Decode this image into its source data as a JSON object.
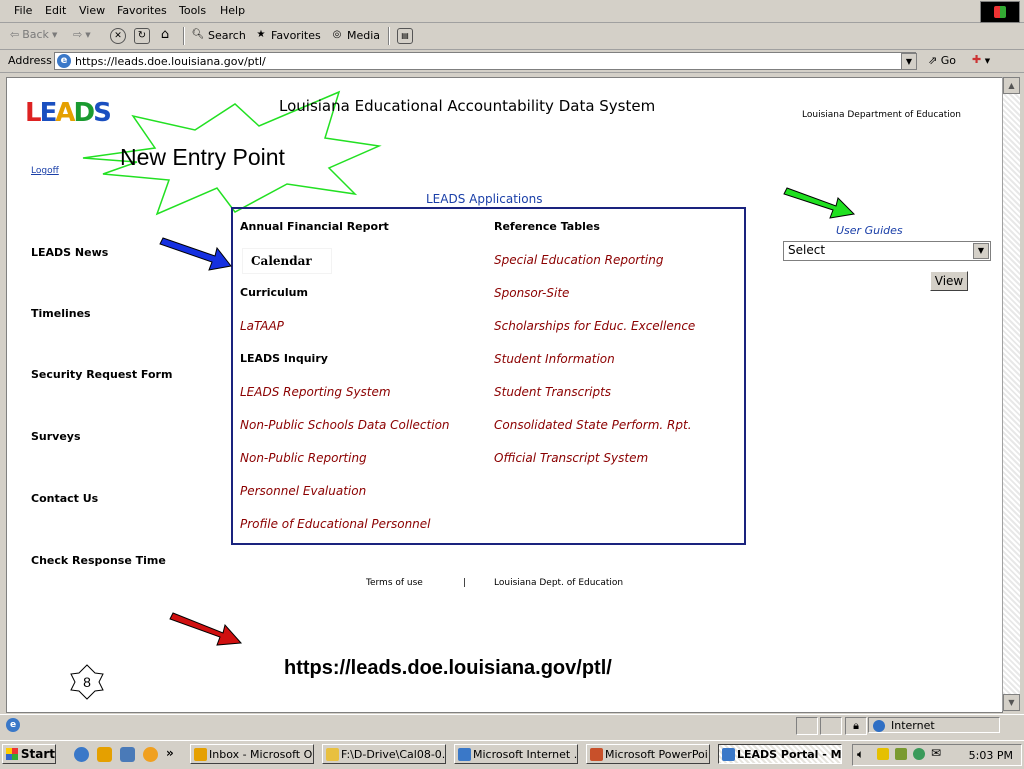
{
  "menu": [
    "File",
    "Edit",
    "View",
    "Favorites",
    "Tools",
    "Help"
  ],
  "toolbar": {
    "back": "Back",
    "search": "Search",
    "favorites": "Favorites",
    "media": "Media"
  },
  "address": {
    "label": "Address",
    "url": "https://leads.doe.louisiana.gov/ptl/",
    "go": "Go"
  },
  "page": {
    "logo_letters": [
      "L",
      "E",
      "A",
      "D",
      "S"
    ],
    "site_title": "Louisiana Educational Accountability Data System",
    "department": "Louisiana Department of Education",
    "logoff": "Logoff",
    "annotation_burst": "New Entry Point",
    "nav": [
      "LEADS News",
      "Timelines",
      "Security Request Form",
      "Surveys",
      "Contact Us",
      "Check Response Time"
    ],
    "apps_title": "LEADS Applications",
    "apps_col1": [
      {
        "text": "Annual Financial Report",
        "kind": "header"
      },
      {
        "text": "Calendar",
        "kind": "callout"
      },
      {
        "text": "Curriculum",
        "kind": "header"
      },
      {
        "text": "LaTAAP",
        "kind": "link"
      },
      {
        "text": "LEADS Inquiry",
        "kind": "header"
      },
      {
        "text": "LEADS Reporting System",
        "kind": "link"
      },
      {
        "text": "Non-Public Schools Data Collection",
        "kind": "link"
      },
      {
        "text": "Non-Public Reporting",
        "kind": "link"
      },
      {
        "text": "Personnel Evaluation",
        "kind": "link"
      },
      {
        "text": "Profile of Educational Personnel",
        "kind": "link"
      }
    ],
    "apps_col2": [
      {
        "text": "Reference Tables",
        "kind": "header"
      },
      {
        "text": "Special Education Reporting",
        "kind": "link"
      },
      {
        "text": "Sponsor-Site",
        "kind": "link"
      },
      {
        "text": "Scholarships for Educ. Excellence",
        "kind": "link"
      },
      {
        "text": "Student Information",
        "kind": "link"
      },
      {
        "text": "Student Transcripts",
        "kind": "link"
      },
      {
        "text": "Consolidated State Perform. Rpt.",
        "kind": "link"
      },
      {
        "text": "Official Transcript System",
        "kind": "link"
      }
    ],
    "user_guides_label": "User Guides",
    "user_guides_value": "Select",
    "view_button": "View",
    "footer_terms": "Terms of use",
    "footer_sep": "|",
    "footer_dept": "Louisiana Dept. of Education",
    "big_url": "https://leads.doe.louisiana.gov/ptl/",
    "slide_number": "8"
  },
  "status": {
    "zone": "Internet"
  },
  "taskbar": {
    "start": "Start",
    "quicklaunch_more": "»",
    "tasks": [
      {
        "label": "Inbox - Microsoft O...",
        "color": "#e5a000"
      },
      {
        "label": "F:\\D-Drive\\Cal08-0...",
        "color": "#e8c040"
      },
      {
        "label": "Microsoft Internet ...",
        "color": "#3a78c8"
      },
      {
        "label": "Microsoft PowerPoi...",
        "color": "#c8502a"
      },
      {
        "label": "LEADS Portal - Mi...",
        "color": "#3a78c8"
      }
    ],
    "clock": "5:03 PM"
  },
  "colors": {
    "link": "#8b0000",
    "accent_blue": "#1a3fa8",
    "box_border": "#1a237e",
    "arrow_blue": "#1530e0",
    "arrow_green": "#20e020",
    "arrow_red": "#d01010"
  }
}
